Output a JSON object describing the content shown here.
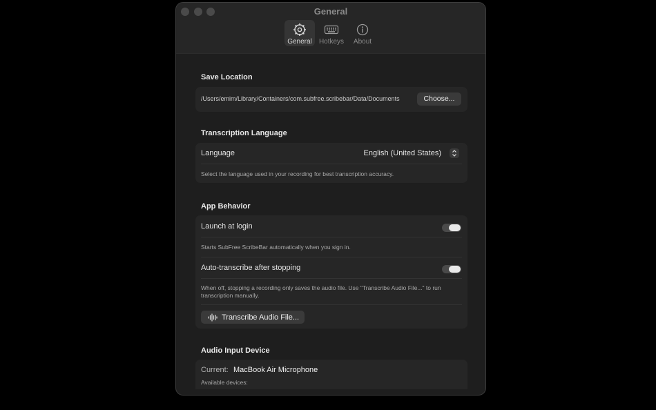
{
  "window": {
    "title": "General"
  },
  "tabs": [
    {
      "label": "General",
      "icon": "gear-icon",
      "active": true
    },
    {
      "label": "Hotkeys",
      "icon": "keyboard-icon",
      "active": false
    },
    {
      "label": "About",
      "icon": "info-icon",
      "active": false
    }
  ],
  "save_location": {
    "title": "Save Location",
    "path": "/Users/emim/Library/Containers/com.subfree.scribebar/Data/Documents",
    "choose_label": "Choose..."
  },
  "transcription_language": {
    "title": "Transcription Language",
    "language_label": "Language",
    "language_value": "English (United States)",
    "description": "Select the language used in your recording for best transcription accuracy."
  },
  "app_behavior": {
    "title": "App Behavior",
    "launch_label": "Launch at login",
    "launch_on": true,
    "launch_desc": "Starts SubFree ScribeBar automatically when you sign in.",
    "auto_label": "Auto-transcribe after stopping",
    "auto_on": true,
    "auto_desc": "When off, stopping a recording only saves the audio file. Use \"Transcribe Audio File...\" to run transcription manually.",
    "transcribe_button": "Transcribe Audio File..."
  },
  "audio_input": {
    "title": "Audio Input Device",
    "current_label": "Current:",
    "current_value": "MacBook Air Microphone",
    "available_label": "Available devices:"
  }
}
